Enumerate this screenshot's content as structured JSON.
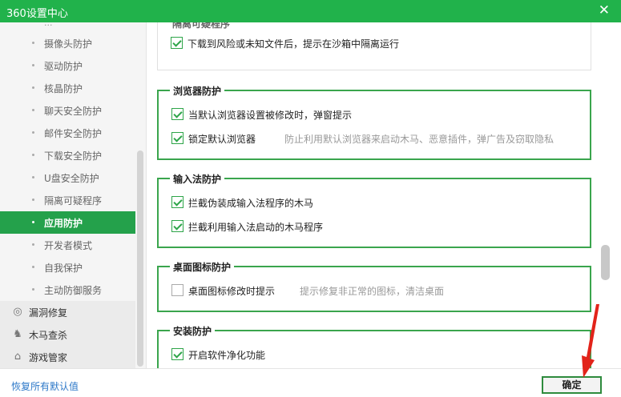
{
  "window": {
    "title": "360设置中心",
    "close_glyph": "✕"
  },
  "sidebar": {
    "partial_label": "...",
    "items": [
      {
        "label": "摄像头防护"
      },
      {
        "label": "驱动防护"
      },
      {
        "label": "核晶防护"
      },
      {
        "label": "聊天安全防护"
      },
      {
        "label": "邮件安全防护"
      },
      {
        "label": "下载安全防护"
      },
      {
        "label": "U盘安全防护"
      },
      {
        "label": "隔离可疑程序"
      },
      {
        "label": "应用防护",
        "active": true
      },
      {
        "label": "开发者模式"
      },
      {
        "label": "自我保护"
      },
      {
        "label": "主动防御服务"
      }
    ],
    "categories": [
      {
        "label": "漏洞修复",
        "icon": "vulnerability-repair-icon",
        "glyph": "◎"
      },
      {
        "label": "木马查杀",
        "icon": "trojan-scan-icon",
        "glyph": "♞"
      },
      {
        "label": "游戏管家",
        "icon": "game-controller-icon",
        "glyph": "⌂"
      }
    ]
  },
  "groups": {
    "isolate": {
      "title": "隔离可疑程序",
      "rows": [
        {
          "label": "下载到风险或未知文件后，提示在沙箱中隔离运行",
          "checked": true
        }
      ]
    },
    "browser": {
      "title": "浏览器防护",
      "rows": [
        {
          "label": "当默认浏览器设置被修改时，弹窗提示",
          "checked": true
        },
        {
          "label": "锁定默认浏览器",
          "checked": true,
          "desc": "防止利用默认浏览器来启动木马、恶意插件，弹广告及窃取隐私"
        }
      ]
    },
    "ime": {
      "title": "输入法防护",
      "rows": [
        {
          "label": "拦截伪装成输入法程序的木马",
          "checked": true
        },
        {
          "label": "拦截利用输入法启动的木马程序",
          "checked": true
        }
      ]
    },
    "desktop": {
      "title": "桌面图标防护",
      "rows": [
        {
          "label": "桌面图标修改时提示",
          "checked": false,
          "desc": "提示修复非正常的图标，清洁桌面"
        }
      ]
    },
    "install": {
      "title": "安装防护",
      "rows": [
        {
          "label": "开启软件净化功能",
          "checked": true
        }
      ]
    }
  },
  "footer": {
    "reset_label": "恢复所有默认值",
    "ok_label": "确定"
  },
  "colors": {
    "brand": "#21b24b",
    "active": "#24a14b",
    "link": "#2d78c8",
    "annotation": "#e2231a"
  }
}
